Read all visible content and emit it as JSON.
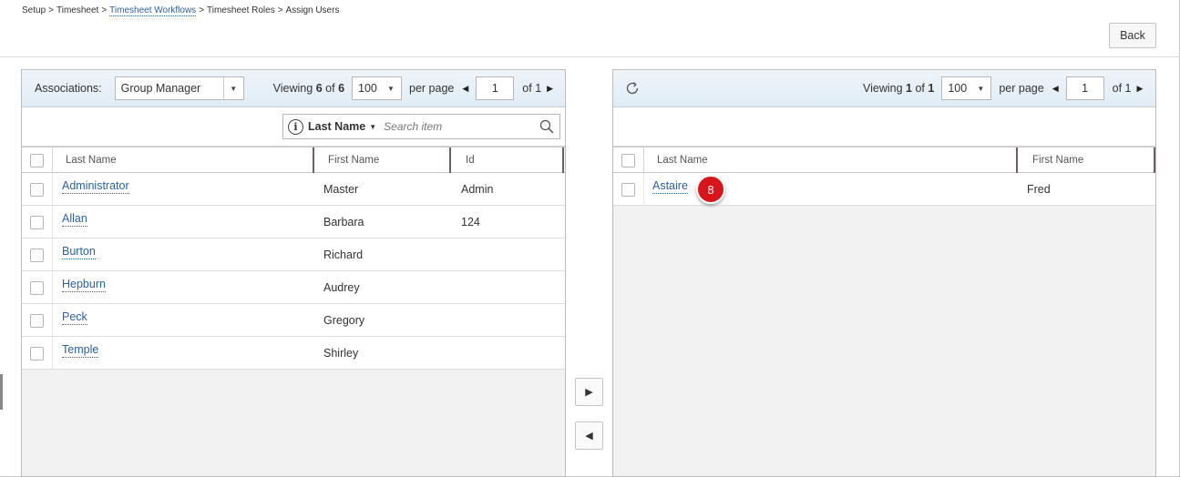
{
  "breadcrumb": {
    "items": [
      "Setup",
      "Timesheet",
      "Timesheet Workflows",
      "Timesheet Roles",
      "Assign Users"
    ],
    "separator": ">"
  },
  "header": {
    "back_label": "Back"
  },
  "left_panel": {
    "associations_label": "Associations:",
    "associations_value": "Group Manager",
    "viewing_prefix": "Viewing",
    "viewing_count": "6",
    "viewing_of": "of",
    "viewing_total": "6",
    "per_page_value": "100",
    "per_page_label": "per page",
    "page_value": "1",
    "of_pages": "of 1",
    "search": {
      "field_label": "Last Name",
      "placeholder": "Search item"
    },
    "columns": [
      "Last Name",
      "First Name",
      "Id"
    ],
    "rows": [
      {
        "last": "Administrator",
        "first": "Master",
        "id": "Admin"
      },
      {
        "last": "Allan",
        "first": "Barbara",
        "id": "124"
      },
      {
        "last": "Burton",
        "first": "Richard",
        "id": ""
      },
      {
        "last": "Hepburn",
        "first": "Audrey",
        "id": ""
      },
      {
        "last": "Peck",
        "first": "Gregory",
        "id": ""
      },
      {
        "last": "Temple",
        "first": "Shirley",
        "id": ""
      }
    ]
  },
  "right_panel": {
    "refresh_icon": "refresh-icon",
    "viewing_prefix": "Viewing",
    "viewing_count": "1",
    "viewing_of": "of",
    "viewing_total": "1",
    "per_page_value": "100",
    "per_page_label": "per page",
    "page_value": "1",
    "of_pages": "of 1",
    "columns": [
      "Last Name",
      "First Name"
    ],
    "rows": [
      {
        "last": "Astaire",
        "first": "Fred"
      }
    ]
  },
  "move_buttons": {
    "right_icon": "triangle-right-icon",
    "left_icon": "triangle-left-icon"
  },
  "annotation_badge": "8",
  "colors": {
    "link": "#2a62a8",
    "toolbar": "#e4eef6",
    "badge": "#d8151b"
  }
}
